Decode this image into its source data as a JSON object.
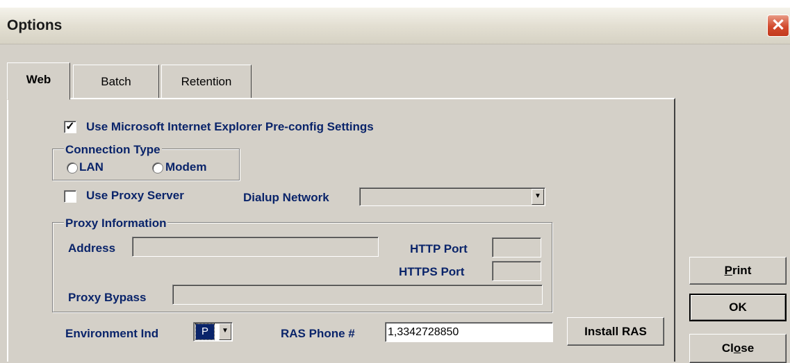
{
  "window": {
    "title": "Options",
    "close_glyph": "✕"
  },
  "tabs": [
    {
      "label": "Web",
      "active": true
    },
    {
      "label": "Batch",
      "active": false
    },
    {
      "label": "Retention",
      "active": false
    }
  ],
  "web": {
    "use_ie_settings": {
      "label": "Use Microsoft Internet Explorer Pre-config Settings",
      "checked": true,
      "mark": "✓"
    },
    "connection_type": {
      "title": "Connection Type",
      "options": [
        {
          "label": "LAN",
          "selected": false
        },
        {
          "label": "Modem",
          "selected": false
        }
      ]
    },
    "use_proxy": {
      "label": "Use Proxy Server",
      "checked": false
    },
    "dialup": {
      "label": "Dialup Network",
      "value": ""
    },
    "proxy": {
      "title": "Proxy Information",
      "address_label": "Address",
      "address_value": "",
      "http_port_label": "HTTP Port",
      "http_port_value": "",
      "https_port_label": "HTTPS Port",
      "https_port_value": "",
      "bypass_label": "Proxy Bypass",
      "bypass_value": ""
    },
    "environment": {
      "label": "Environment Ind",
      "value": "P"
    },
    "ras_phone": {
      "label": "RAS Phone #",
      "value": "1,3342728850"
    },
    "install_ras_label": "Install RAS"
  },
  "buttons": {
    "print": {
      "accel": "P",
      "rest": "rint"
    },
    "ok": "OK",
    "close": {
      "pre": "Cl",
      "accel": "o",
      "rest": "se"
    }
  },
  "icons": {
    "dropdown": "chevron-down-icon",
    "close": "close-icon"
  },
  "colors": {
    "label_text": "#0a246a",
    "dialog_bg": "#d4d0c8",
    "close_button": "#d24a2d"
  }
}
